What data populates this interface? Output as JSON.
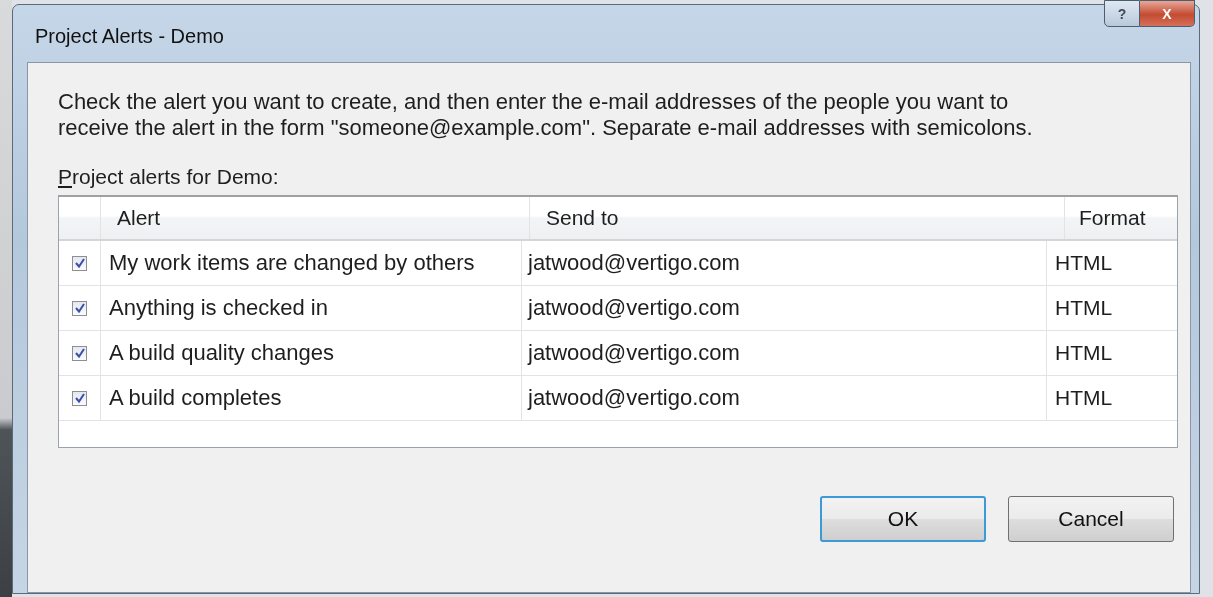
{
  "window": {
    "title": "Project Alerts - Demo",
    "help_button": "?",
    "close_button": "X"
  },
  "instructions": "Check the alert you want to create, and then enter the e-mail addresses of the people you want to receive the alert in the form \"someone@example.com\". Separate e-mail addresses with semicolons.",
  "table_label": "Project alerts for Demo:",
  "table": {
    "columns": [
      "Alert",
      "Send to",
      "Format"
    ],
    "rows": [
      {
        "checked": true,
        "alert": "My work items are changed by others",
        "send_to": "jatwood@vertigo.com",
        "format": "HTML"
      },
      {
        "checked": true,
        "alert": "Anything is checked in",
        "send_to": "jatwood@vertigo.com",
        "format": "HTML"
      },
      {
        "checked": true,
        "alert": "A build quality changes",
        "send_to": "jatwood@vertigo.com",
        "format": "HTML"
      },
      {
        "checked": true,
        "alert": "A build completes",
        "send_to": "jatwood@vertigo.com",
        "format": "HTML"
      }
    ]
  },
  "buttons": [
    {
      "label": "OK",
      "default": true
    },
    {
      "label": "Cancel",
      "default": false
    }
  ]
}
